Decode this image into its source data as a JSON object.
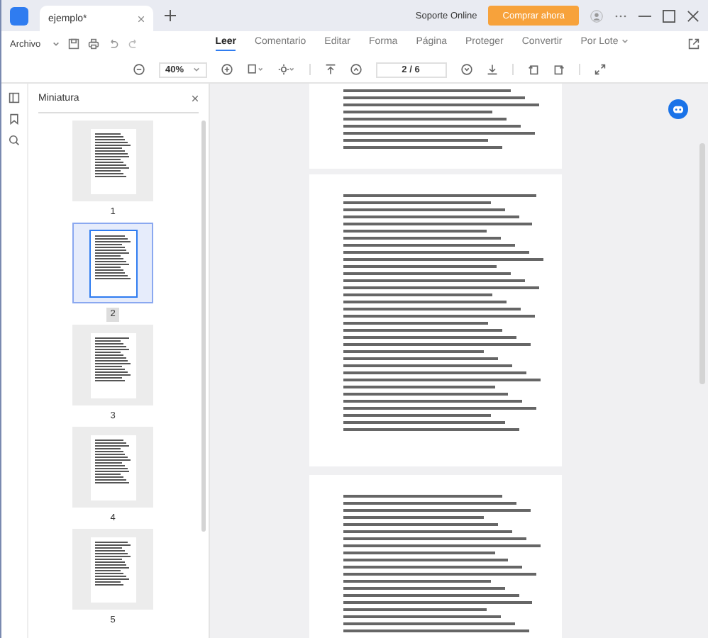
{
  "tab": {
    "title": "ejemplo*"
  },
  "header": {
    "support": "Soporte Online",
    "buy": "Comprar ahora"
  },
  "menu": {
    "file": "Archivo",
    "tabs": [
      {
        "label": "Leer",
        "selected": true,
        "kind": "plain"
      },
      {
        "label": "Comentario",
        "selected": false,
        "kind": "plain"
      },
      {
        "label": "Editar",
        "selected": false,
        "kind": "plain"
      },
      {
        "label": "Forma",
        "selected": false,
        "kind": "plain"
      },
      {
        "label": "Página",
        "selected": false,
        "kind": "plain"
      },
      {
        "label": "Proteger",
        "selected": false,
        "kind": "plain"
      },
      {
        "label": "Convertir",
        "selected": false,
        "kind": "plain"
      },
      {
        "label": "Por Lote",
        "selected": false,
        "kind": "dropdown"
      }
    ]
  },
  "toolbar": {
    "zoom": "40%",
    "page": "2 / 6"
  },
  "sidebar": {
    "title": "Miniatura",
    "thumbnails": [
      {
        "label": "1",
        "selected": false
      },
      {
        "label": "2",
        "selected": true
      },
      {
        "label": "3",
        "selected": false
      },
      {
        "label": "4",
        "selected": false
      },
      {
        "label": "5",
        "selected": false
      }
    ]
  }
}
